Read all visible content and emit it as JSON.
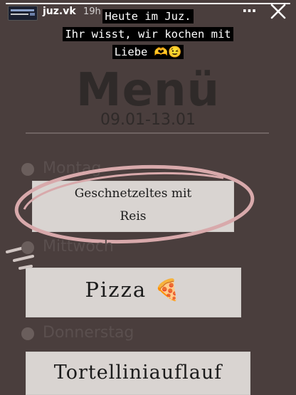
{
  "story": {
    "username": "juz.vk",
    "time": "19h",
    "progress_fraction": 1.0,
    "caption_lines": [
      "Heute im Juz.",
      "Ihr wisst, wir kochen mit",
      "Liebe 🫶😉"
    ]
  },
  "menu": {
    "title": "Menü",
    "date_range": "09.01-13.01",
    "days": [
      {
        "day": "Montag",
        "dish_line1": "Geschnetzeltes mit",
        "dish_line2": "Reis"
      },
      {
        "day": "Mittwoch",
        "dish": "Pizza 🍕"
      },
      {
        "day": "Donnerstag",
        "dish": "Tortelliniauflauf"
      }
    ]
  },
  "icons": {
    "more": "more-horizontal-icon",
    "close": "close-icon",
    "avatar": "profile-avatar"
  },
  "colors": {
    "background": "#4a3e3d",
    "accent_pink": "#d8a9ab",
    "card": "#d9d4d1"
  }
}
